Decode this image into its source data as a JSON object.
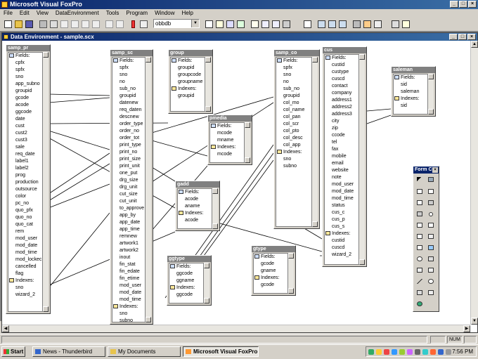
{
  "app": {
    "title": "Microsoft Visual FoxPro"
  },
  "menu": [
    "File",
    "Edit",
    "View",
    "DataEnvironment",
    "Tools",
    "Program",
    "Window",
    "Help"
  ],
  "toolbar": {
    "combo_value": "obbdb"
  },
  "de_window": {
    "title": "Data Environment - sample.scx"
  },
  "tables": {
    "samp_pr": {
      "name": "samp_pr",
      "fields_label": "Fields:",
      "fields": [
        "cpfx",
        "spfx",
        "sno",
        "app_subno",
        "groupid",
        "gcode",
        "acode",
        "ggcode",
        "date",
        "cust",
        "cust2",
        "cust3",
        "sale",
        "req_date",
        "label1",
        "label2",
        "prog",
        "production",
        "outsource",
        "color",
        "pc_no",
        "quo_pfx",
        "quo_no",
        "quo_cat",
        "rem",
        "mod_user",
        "mod_date",
        "mod_time",
        "mod_lockec",
        "cancelled",
        "flag"
      ],
      "indexes_label": "Indexes:",
      "indexes": [
        "sno",
        "wizard_2"
      ]
    },
    "samp_sc": {
      "name": "samp_sc",
      "fields_label": "Fields:",
      "fields": [
        "spfx",
        "sno",
        "no",
        "sub_no",
        "groupid",
        "datenew",
        "req_daten",
        "descnew",
        "order_type",
        "order_no",
        "order_tot",
        "print_type",
        "print_no",
        "print_size",
        "print_unit",
        "one_put",
        "drg_size",
        "drg_unit",
        "cut_size",
        "cut_unit",
        "to_approve",
        "app_by",
        "app_date",
        "app_time",
        "remnew",
        "artwork1",
        "artwork2",
        "inout",
        "fin_stat",
        "fin_edate",
        "fin_etime",
        "mod_user",
        "mod_date",
        "mod_time"
      ],
      "indexes_label": "Indexes:",
      "indexes": [
        "sno",
        "subno"
      ]
    },
    "group": {
      "name": "group",
      "fields_label": "Fields:",
      "fields": [
        "groupid",
        "groupcode",
        "groupname"
      ],
      "indexes_label": "Indexes:",
      "indexes": [
        "groupid"
      ]
    },
    "pmedia": {
      "name": "pmedia",
      "fields_label": "Fields:",
      "fields": [
        "mcode",
        "mname"
      ],
      "indexes_label": "Indexes:",
      "indexes": [
        "mcode"
      ]
    },
    "gadd": {
      "name": "gadd",
      "fields_label": "Fields:",
      "fields": [
        "acode",
        "aname"
      ],
      "indexes_label": "Indexes:",
      "indexes": [
        "acode"
      ]
    },
    "ggtype": {
      "name": "ggtype",
      "fields_label": "Fields:",
      "fields": [
        "ggcode",
        "ggname"
      ],
      "indexes_label": "Indexes:",
      "indexes": [
        "ggcode"
      ]
    },
    "gtype": {
      "name": "gtype",
      "fields_label": "Fields:",
      "fields": [
        "gcode",
        "gname"
      ],
      "indexes_label": "Indexes:",
      "indexes": [
        "gcode"
      ]
    },
    "samp_co": {
      "name": "samp_co",
      "fields_label": "Fields:",
      "fields": [
        "spfx",
        "sno",
        "no",
        "sub_no",
        "groupid",
        "col_mo",
        "col_name",
        "col_pan",
        "col_scr",
        "col_pto",
        "col_desc",
        "col_app"
      ],
      "indexes_label": "Indexes:",
      "indexes": [
        "sno",
        "subno"
      ]
    },
    "cus": {
      "name": "cus",
      "fields_label": "Fields:",
      "fields": [
        "custid",
        "custype",
        "cuscd",
        "contact",
        "company",
        "address1",
        "address2",
        "address3",
        "city",
        "zip",
        "ccode",
        "tel",
        "fax",
        "mobile",
        "email",
        "website",
        "note",
        "mod_user",
        "mod_date",
        "mod_time",
        "status",
        "cus_c",
        "cus_p",
        "cus_s"
      ],
      "indexes_label": "Indexes:",
      "indexes": [
        "custid",
        "cuscd",
        "wizard_2"
      ]
    },
    "saleman": {
      "name": "saleman",
      "fields_label": "Fields:",
      "fields": [
        "sid",
        "saleman"
      ],
      "indexes_label": "Indexes:",
      "indexes": [
        "sid"
      ]
    }
  },
  "form_controls": {
    "title": "Form C"
  },
  "status": {
    "num": "NUM"
  },
  "taskbar": {
    "start": "Start",
    "tasks": [
      "News - Thunderbird",
      "My Documents",
      "Microsoft Visual FoxPro"
    ],
    "clock": "7:56 PM"
  },
  "colors": {
    "title_start": "#0a246a",
    "title_end": "#3a6ea5",
    "face": "#d4d0c8"
  }
}
